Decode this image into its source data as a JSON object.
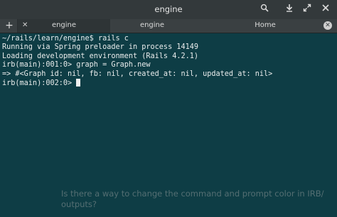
{
  "window": {
    "title": "engine",
    "icons": [
      "search-icon",
      "download-icon",
      "expand-icon",
      "close-icon"
    ]
  },
  "tabs": [
    {
      "label": "engine",
      "active": true
    },
    {
      "label": "engine",
      "active": false
    },
    {
      "label": "Home",
      "active": false
    }
  ],
  "terminal": {
    "lines": [
      {
        "type": "prompt",
        "path": "~/rails/learn/engine$",
        "command": " rails c"
      },
      {
        "type": "output",
        "text": "Running via Spring preloader in process 14149"
      },
      {
        "type": "output",
        "text": "Loading development environment (Rails 4.2.1)"
      },
      {
        "type": "output",
        "text": "irb(main):001:0> graph = Graph.new"
      },
      {
        "type": "output",
        "text": "=> #<Graph id: nil, fb: nil, created_at: nil, updated_at: nil>"
      },
      {
        "type": "output",
        "text": "irb(main):002:0> "
      }
    ]
  },
  "overlay": {
    "text": "Is there a way to change the command and prompt color in IRB/ outputs?"
  }
}
